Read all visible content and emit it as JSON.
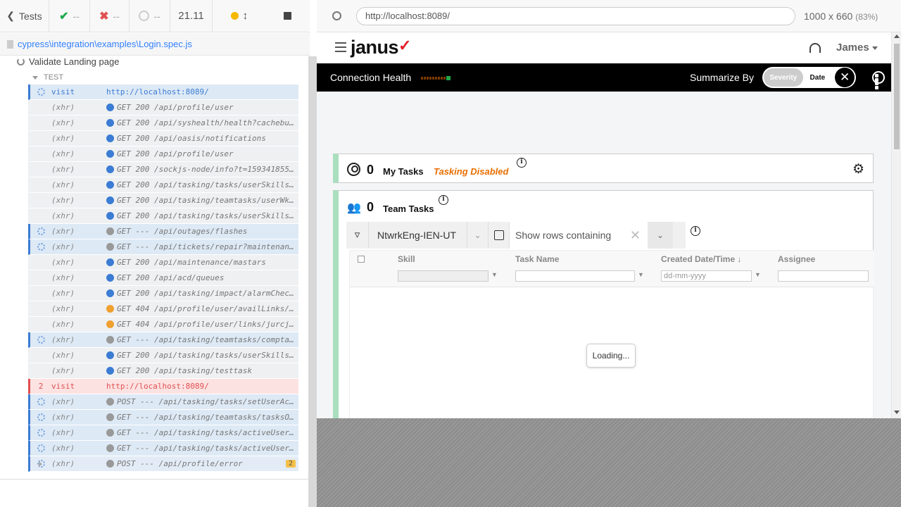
{
  "reporter": {
    "tests_label": "Tests",
    "passed": "--",
    "failed": "--",
    "pending": "--",
    "duration": "21.11",
    "spec_path": "cypress\\integration\\examples\\Login.spec.js",
    "suite_title": "Validate Landing page",
    "test_label": "TEST",
    "commands": [
      {
        "num": "",
        "state": "pending",
        "kind": "visit",
        "name": "visit",
        "dot": "",
        "msg": "http://localhost:8089/"
      },
      {
        "num": "",
        "state": "",
        "kind": "xhr",
        "name": "(xhr)",
        "dot": "blue",
        "msg": "GET 200 /api/profile/user"
      },
      {
        "num": "",
        "state": "",
        "kind": "xhr",
        "name": "(xhr)",
        "dot": "blue",
        "msg": "GET 200 /api/syshealth/health?cachebu…"
      },
      {
        "num": "",
        "state": "",
        "kind": "xhr",
        "name": "(xhr)",
        "dot": "blue",
        "msg": "GET 200 /api/oasis/notifications"
      },
      {
        "num": "",
        "state": "",
        "kind": "xhr",
        "name": "(xhr)",
        "dot": "blue",
        "msg": "GET 200 /api/profile/user"
      },
      {
        "num": "",
        "state": "",
        "kind": "xhr",
        "name": "(xhr)",
        "dot": "blue",
        "msg": "GET 200 /sockjs-node/info?t=159341855…"
      },
      {
        "num": "",
        "state": "",
        "kind": "xhr",
        "name": "(xhr)",
        "dot": "blue",
        "msg": "GET 200 /api/tasking/tasks/userSkills…"
      },
      {
        "num": "",
        "state": "",
        "kind": "xhr",
        "name": "(xhr)",
        "dot": "blue",
        "msg": "GET 200 /api/tasking/teamtasks/userWk…"
      },
      {
        "num": "",
        "state": "",
        "kind": "xhr",
        "name": "(xhr)",
        "dot": "blue",
        "msg": "GET 200 /api/tasking/tasks/userSkills…"
      },
      {
        "num": "",
        "state": "pending",
        "kind": "xhr",
        "name": "(xhr)",
        "dot": "grey",
        "msg": "GET --- /api/outages/flashes"
      },
      {
        "num": "",
        "state": "pending",
        "kind": "xhr",
        "name": "(xhr)",
        "dot": "grey",
        "msg": "GET --- /api/tickets/repair?maintenan…"
      },
      {
        "num": "",
        "state": "",
        "kind": "xhr",
        "name": "(xhr)",
        "dot": "blue",
        "msg": "GET 200 /api/maintenance/mastars"
      },
      {
        "num": "",
        "state": "",
        "kind": "xhr",
        "name": "(xhr)",
        "dot": "blue",
        "msg": "GET 200 /api/acd/queues"
      },
      {
        "num": "",
        "state": "",
        "kind": "xhr",
        "name": "(xhr)",
        "dot": "blue",
        "msg": "GET 200 /api/tasking/impact/alarmChec…"
      },
      {
        "num": "",
        "state": "",
        "kind": "xhr",
        "name": "(xhr)",
        "dot": "orange",
        "msg": "GET 404 /api/profile/user/availLinks/…"
      },
      {
        "num": "",
        "state": "",
        "kind": "xhr",
        "name": "(xhr)",
        "dot": "orange",
        "msg": "GET 404 /api/profile/user/links/jurcj…"
      },
      {
        "num": "",
        "state": "pending",
        "kind": "xhr",
        "name": "(xhr)",
        "dot": "grey",
        "msg": "GET --- /api/tasking/teamtasks/compta…"
      },
      {
        "num": "",
        "state": "",
        "kind": "xhr",
        "name": "(xhr)",
        "dot": "blue",
        "msg": "GET 200 /api/tasking/tasks/userSkills…"
      },
      {
        "num": "",
        "state": "",
        "kind": "xhr",
        "name": "(xhr)",
        "dot": "blue",
        "msg": "GET 200 /api/tasking/testtask"
      },
      {
        "num": "2",
        "state": "failed",
        "kind": "visit",
        "name": "visit",
        "dot": "",
        "msg": "http://localhost:8089/"
      },
      {
        "num": "",
        "state": "pending",
        "kind": "xhr",
        "name": "(xhr)",
        "dot": "grey",
        "msg": "POST --- /api/tasking/tasks/setUserAc…"
      },
      {
        "num": "",
        "state": "pending",
        "kind": "xhr",
        "name": "(xhr)",
        "dot": "grey",
        "msg": "GET --- /api/tasking/teamtasks/tasksO…"
      },
      {
        "num": "",
        "state": "pending",
        "kind": "xhr",
        "name": "(xhr)",
        "dot": "grey",
        "msg": "GET --- /api/tasking/tasks/activeUser…"
      },
      {
        "num": "",
        "state": "pending",
        "kind": "xhr",
        "name": "(xhr)",
        "dot": "grey",
        "msg": "GET --- /api/tasking/tasks/activeUser…"
      },
      {
        "num": "",
        "state": "pending-plain",
        "kind": "xhr",
        "name": "(xhr)",
        "dot": "grey",
        "msg": "POST --- /api/profile/error",
        "badge": "2"
      }
    ]
  },
  "aut_header": {
    "url": "http://localhost:8089/",
    "viewport": "1000 x 660",
    "zoom": "(83%)"
  },
  "app": {
    "logo": "janus",
    "user": "James",
    "connection_health": "Connection Health",
    "summarize_by": "Summarize By",
    "summarize_options": {
      "severity": "Severity",
      "date": "Date"
    },
    "close_symbol": "✕",
    "my_tasks": {
      "count": "0",
      "label": "My Tasks",
      "status": "Tasking Disabled"
    },
    "team_tasks": {
      "count": "0",
      "label": "Team Tasks",
      "team_select": "NtwrkEng-IEN-UT",
      "rows_placeholder": "Show rows containing",
      "columns": [
        "Skill",
        "Task Name",
        "Created Date/Time ↓",
        "Assignee"
      ],
      "date_placeholder": "dd-mm-yyyy",
      "loading": "Loading..."
    }
  },
  "colors": {
    "accent_blue": "#3b7cd4",
    "failed_red": "#e05050",
    "tasking_disabled": "#e86e00",
    "logo_check": "#e31b23",
    "panel_accent": "#a9dfbf"
  }
}
